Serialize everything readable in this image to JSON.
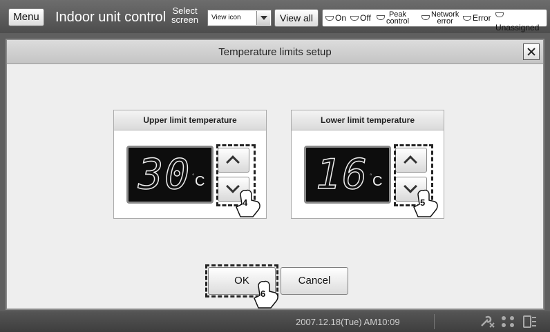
{
  "header": {
    "menu_label": "Menu",
    "title": "Indoor unit control",
    "select_screen_line1": "Select",
    "select_screen_line2": "screen",
    "view_select_value": "View icon",
    "view_all_label": "View all",
    "legend": [
      {
        "icon": "on-lamp-icon",
        "label": "On"
      },
      {
        "icon": "off-lamp-icon",
        "label": "Off"
      },
      {
        "icon": "peak-control-lamp-icon",
        "label_line1": "Peak",
        "label_line2": "control"
      },
      {
        "icon": "network-error-lamp-icon",
        "label_line1": "Network",
        "label_line2": "error"
      },
      {
        "icon": "error-lamp-icon",
        "label": "Error"
      },
      {
        "icon": "unassigned-lamp-icon",
        "label": "Unassigned"
      }
    ]
  },
  "dialog": {
    "title": "Temperature limits setup",
    "upper": {
      "title": "Upper limit temperature",
      "value": "30",
      "unit": "C",
      "degree": "°"
    },
    "lower": {
      "title": "Lower limit temperature",
      "value": "16",
      "unit": "C",
      "degree": "°"
    },
    "ok_label": "OK",
    "cancel_label": "Cancel"
  },
  "annotations": {
    "step_upper_down": "4",
    "step_lower_down": "5",
    "step_ok": "6"
  },
  "status": {
    "datetime": "2007.12.18(Tue) AM10:09"
  },
  "colors": {
    "toolbar": "#5a5a5a",
    "panel": "#eeeeee",
    "lcd": "#0d0d0d",
    "button": "#ffffff"
  }
}
